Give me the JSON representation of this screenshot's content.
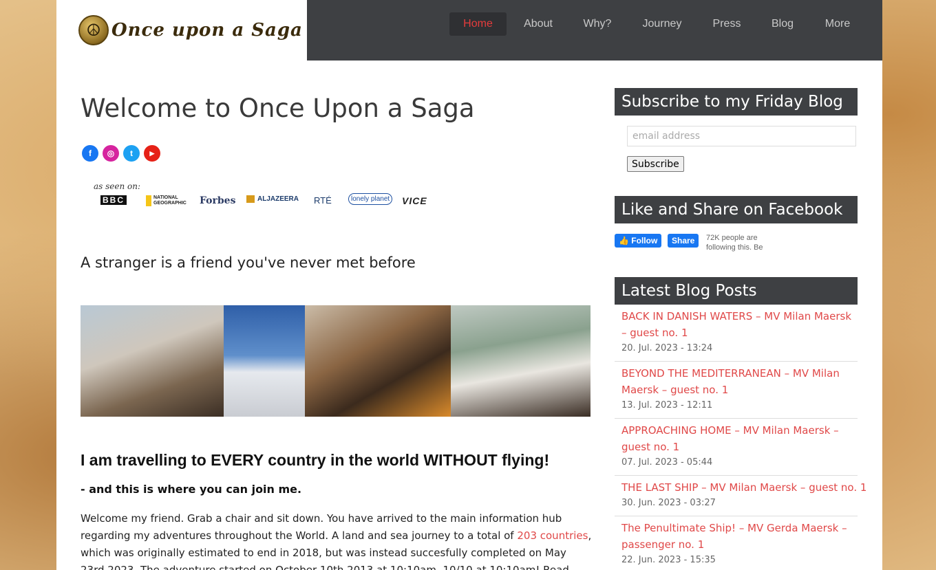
{
  "logo": {
    "emblem": "☮",
    "text": "Once upon a Saga"
  },
  "nav": {
    "items": [
      {
        "label": "Home",
        "active": true
      },
      {
        "label": "About"
      },
      {
        "label": "Why?"
      },
      {
        "label": "Journey"
      },
      {
        "label": "Press"
      },
      {
        "label": "Blog"
      },
      {
        "label": "More"
      }
    ],
    "search_icon": "search-icon"
  },
  "main": {
    "title": "Welcome to Once Upon a Saga",
    "social": [
      "f",
      "◎",
      "t",
      "▶"
    ],
    "seen_on": {
      "label": "as seen on:",
      "outlets": [
        "BBC",
        "NATIONAL GEOGRAPHIC",
        "Forbes",
        "ALJAZEERA",
        "RTÉ",
        "lonely planet",
        "VICE"
      ]
    },
    "tagline": "A stranger is a friend you've never met before",
    "headline": "I am travelling to EVERY country in the world WITHOUT flying!",
    "subheadline": "- and this is where you can join me.",
    "body_before_link": "Welcome my friend. Grab a chair and sit down. You have arrived to the main information hub regarding my adventures throughout the World. A land and sea journey to a total of ",
    "body_link": "203 countries",
    "body_after_link": ", which was originally estimated to end in 2018, but was instead succesfully completed on May 23rd 2023. The adventure started on October 10th 2013 at 10:10am. 10/10 at 10:10am! Read much much more in"
  },
  "sidebar": {
    "subscribe_title": "Subscribe to my Friday Blog",
    "email_placeholder": "email address",
    "subscribe_button": "Subscribe",
    "facebook_title": "Like and Share on Facebook",
    "follow_label": "Follow",
    "share_label": "Share",
    "follow_count": "72K people are following this. Be",
    "latest_title": "Latest Blog Posts",
    "posts": [
      {
        "title": "BACK IN DANISH WATERS – MV Milan Maersk – guest no. 1",
        "date": "20. Jul. 2023 - 13:24"
      },
      {
        "title": "BEYOND THE MEDITERRANEAN – MV Milan Maersk – guest no. 1",
        "date": "13. Jul. 2023 - 12:11"
      },
      {
        "title": "APPROACHING HOME – MV Milan Maersk – guest no. 1",
        "date": "07. Jul. 2023 - 05:44"
      },
      {
        "title": "THE LAST SHIP – MV Milan Maersk – guest no. 1",
        "date": "30. Jun. 2023 - 03:27"
      },
      {
        "title": "The Penultimate Ship! – MV Gerda Maersk – passenger no. 1",
        "date": "22. Jun. 2023 - 15:35"
      }
    ]
  }
}
